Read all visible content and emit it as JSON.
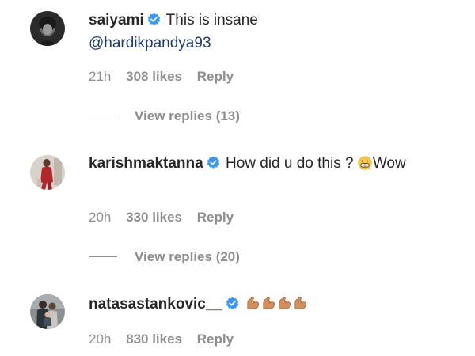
{
  "comments": [
    {
      "username": "saiyami",
      "verified": true,
      "text": "This is insane",
      "mention": "@hardikpandya93",
      "time": "21h",
      "likes": "308 likes",
      "reply_label": "Reply",
      "view_replies": "View replies (13)"
    },
    {
      "username": "karishmaktanna",
      "verified": true,
      "text_before_emoji": "How did u do this ?",
      "emoji": "grimacing-face",
      "text_after_emoji": "Wow",
      "time": "20h",
      "likes": "330 likes",
      "reply_label": "Reply",
      "view_replies": "View replies (20)"
    },
    {
      "username": "natasastankovic__",
      "verified": true,
      "emoji": "flexed-biceps",
      "emoji_count": 4,
      "time": "20h",
      "likes": "830 likes",
      "reply_label": "Reply"
    }
  ],
  "colors": {
    "text": "#262626",
    "secondary": "#8e8e8e",
    "verified_badge": "#3897f0",
    "mention": "#1e3a6e",
    "emoji_flex": "#d4905c"
  }
}
